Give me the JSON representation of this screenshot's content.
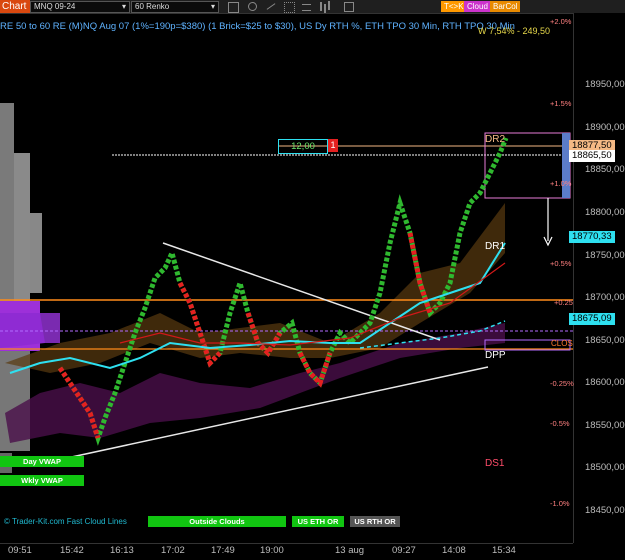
{
  "toolbar": {
    "chart_tab": "Chart",
    "instrument": "MNQ 09-24",
    "period": "60 Renko",
    "buttons": [
      {
        "label": "T<>K",
        "color": "#ff9900"
      },
      {
        "label": "Cloud",
        "color": "#cc33cc"
      },
      {
        "label": "BarCol",
        "color": "#e88a00"
      }
    ]
  },
  "chart": {
    "title": "RE 50 to 60 RE (M)NQ Aug 07 (1%=190p=$380) (1 Brick=$25 to $30), US Dy RTH %, ETH TPO 30 Min, RTH TPO 30 Min",
    "w_value": "W 7,54% - 249,50",
    "box_value": "12,00",
    "box_flag": "1",
    "levels": {
      "dr2": "DR2",
      "dr1": "DR1",
      "dpp": "DPP",
      "ds1": "DS1",
      "clos": "CLOS"
    },
    "status_text": "© Trader-Kit.com Fast Cloud Lines"
  },
  "y_axis": {
    "ticks": [
      "18950,00",
      "18900,00",
      "18850,00",
      "18800,00",
      "18750,00",
      "18700,00",
      "18650,00",
      "18600,00",
      "18550,00",
      "18500,00",
      "18450,00"
    ],
    "percent": [
      "+2.0%",
      "+1.5%",
      "+1.0%",
      "+0.5%",
      "+0.25",
      "-0.25%",
      "-0.5%",
      "-1.0%"
    ],
    "tags": [
      {
        "label": "18877,50",
        "color": "#f4b985"
      },
      {
        "label": "18865,50",
        "color": "#ffffff"
      },
      {
        "label": "18770,33",
        "color": "#2ee0f0"
      },
      {
        "label": "18675,09",
        "color": "#2ee0f0"
      }
    ]
  },
  "x_axis": {
    "ticks": [
      "09:51",
      "15:42",
      "16:13",
      "17:02",
      "17:49",
      "19:00",
      "13 aug",
      "09:27",
      "14:08",
      "15:34"
    ]
  },
  "buttons": {
    "day_vwap": "Day VWAP",
    "wkly_vwap": "Wkly VWAP",
    "outside_clouds": "Outside Clouds",
    "us_eth_or": "US ETH OR",
    "us_rth_or": "US RTH OR"
  }
}
